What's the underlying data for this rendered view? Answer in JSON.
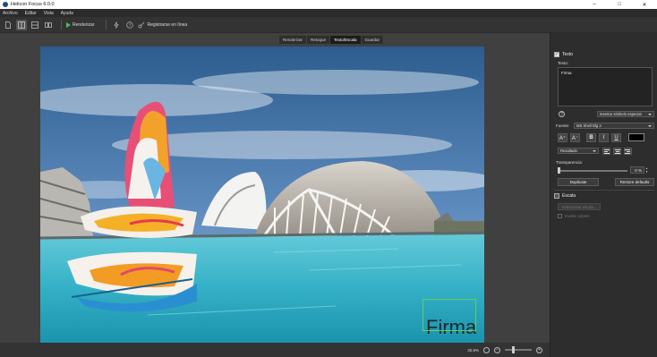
{
  "window": {
    "title": "Helicon Focus 6.0.0",
    "minimize": "–",
    "maximize": "□",
    "close": "✕"
  },
  "menu": [
    "Archivo",
    "Editar",
    "Vista",
    "Ayuda"
  ],
  "toolbar": {
    "render_label": "Renderizar",
    "register_label": "Registrarse en línea"
  },
  "tabs": [
    "Renderizar",
    "Retoque",
    "Texto/Escala",
    "Guardar"
  ],
  "active_tab": "Texto/Escala",
  "photo": {
    "signature_text": "Firma"
  },
  "status": {
    "zoom": "30.5%",
    "zoom_out": "−",
    "zoom_in": "+"
  },
  "text_section": {
    "header": "Texto",
    "enabled": true,
    "text_label": "Texto:",
    "text_value": "Firma",
    "help": "?",
    "insert_symbol": "Insertar símbolo especial",
    "font_label": "Fuente:",
    "font_value": "MS Shell Dlg 2",
    "grow_font": "A⁺",
    "shrink_font": "A⁻",
    "bold": "B",
    "italic": "I",
    "underline": "U",
    "color": "#000000",
    "effect": "Resaltado",
    "transparency_label": "Transparencia:",
    "transparency_value": "0 %",
    "transparency_fraction": 0,
    "duplicate": "Duplicate",
    "restore": "Restore defaults"
  },
  "scale_section": {
    "header": "Escala",
    "enabled": false,
    "select_scale": "Seleccionar escala...",
    "invert_colors": "Invertir colores"
  }
}
